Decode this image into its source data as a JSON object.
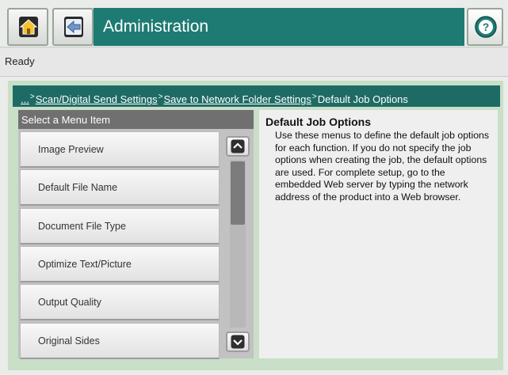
{
  "header": {
    "title": "Administration",
    "home_icon": "home-icon",
    "back_icon": "back-arrow-icon",
    "help_icon": "help-question-icon",
    "title_bg": "#1e7b74"
  },
  "status": {
    "text": "Ready"
  },
  "breadcrumb": {
    "ellipsis": "...",
    "items": [
      "Scan/Digital Send Settings",
      "Save to Network Folder Settings"
    ],
    "current": "Default Job Options",
    "separator": ">"
  },
  "menu": {
    "header": "Select a Menu Item",
    "items": [
      "Image Preview",
      "Default File Name",
      "Document File Type",
      "Optimize Text/Picture",
      "Output Quality",
      "Original Sides"
    ]
  },
  "info": {
    "title": "Default Job Options",
    "body": "Use these menus to define the default job options for each function. If you do not specify the job options when creating the job, the default options are used. For complete setup, go to the embedded Web server by typing the network address of the product into a Web browser."
  }
}
